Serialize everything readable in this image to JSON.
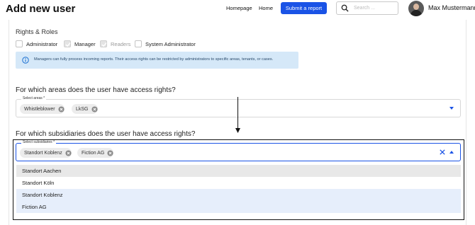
{
  "header": {
    "title": "Add new user",
    "nav": [
      "Homepage",
      "Home"
    ],
    "submit_label": "Submit a report",
    "search_placeholder": "Search ...",
    "user_name": "Max Mustermann"
  },
  "rights": {
    "label": "Rights & Roles",
    "roles": [
      {
        "label": "Administrator",
        "checked": false,
        "disabled": false
      },
      {
        "label": "Manager",
        "checked": true,
        "disabled": false
      },
      {
        "label": "Readers",
        "checked": true,
        "disabled": true
      },
      {
        "label": "System Administrator",
        "checked": false,
        "disabled": false
      }
    ],
    "info": "Managers can fully process incoming reports. Their access rights can be restricted by administrators to specific areas, tenants, or cases."
  },
  "areas": {
    "question": "For which areas does the user have access rights?",
    "field_label": "Select areas *",
    "chips": [
      "Whistleblower",
      "LkSG"
    ]
  },
  "subsidiaries": {
    "question": "For which subsidiaries does the user have access rights?",
    "field_label": "Select subsidiaries *",
    "chips": [
      "Standort Koblenz",
      "Fiction AG"
    ],
    "options": [
      {
        "label": "Standort Aachen",
        "state": "hover"
      },
      {
        "label": "Standort Köln",
        "state": "normal"
      },
      {
        "label": "Standort Koblenz",
        "state": "selected"
      },
      {
        "label": "Fiction AG",
        "state": "selected"
      }
    ]
  },
  "colors": {
    "accent": "#1a53e6",
    "info_bg": "#d5e8f8",
    "option_hover": "#e8e8e8",
    "option_selected": "#e6eefb"
  },
  "icons": [
    "search-icon",
    "info-icon",
    "chip-remove-icon",
    "chevron-down-icon",
    "chevron-up-icon",
    "clear-icon",
    "arrow-down-icon",
    "check-icon"
  ]
}
